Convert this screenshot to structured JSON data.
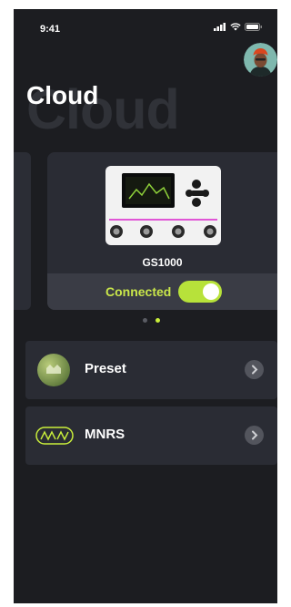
{
  "status_bar": {
    "time": "9:41"
  },
  "header": {
    "title": "Cloud",
    "title_ghost": "Cloud"
  },
  "device_card": {
    "device_name": "GS1000",
    "status_label": "Connected",
    "connected": true
  },
  "carousel": {
    "pages": 2,
    "active_index": 1
  },
  "menu": [
    {
      "label": "Preset",
      "icon": "preset-icon"
    },
    {
      "label": "MNRS",
      "icon": "mnrs-icon"
    }
  ],
  "colors": {
    "background": "#1c1d21",
    "card": "#2a2c34",
    "accent": "#c9ee3b",
    "toggle": "#b7e23a"
  }
}
